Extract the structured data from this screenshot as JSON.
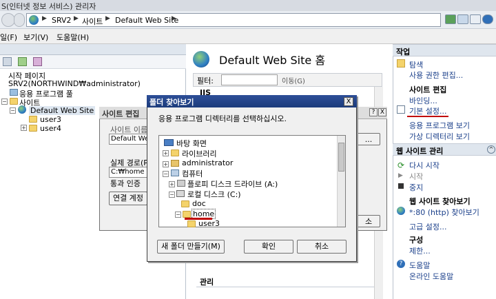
{
  "window": {
    "title": "S(인터넷 정보 서비스) 관리자"
  },
  "address": {
    "crumbs": [
      "SRV2",
      "사이트",
      "Default Web Site"
    ]
  },
  "menu": {
    "items": [
      "일(F)",
      "보기(V)",
      "도움말(H)"
    ]
  },
  "left": {
    "header": "",
    "tree": [
      {
        "label": "시작 페이지"
      },
      {
        "label": "SRV2(NORTHWIND₩administrator)"
      },
      {
        "label": "응용 프로그램 풀"
      },
      {
        "label": "사이트"
      },
      {
        "label": "Default Web Site"
      },
      {
        "label": "user3"
      },
      {
        "label": "user4"
      }
    ]
  },
  "center": {
    "title": "Default Web Site 홈",
    "filter_label": "필터:",
    "go_label": "이동(G)",
    "group_iis": "IIS",
    "group_manage": "관리"
  },
  "actions": {
    "header": "작업",
    "explore": "탐색",
    "edit_perms": "사용 권한 편집...",
    "site_edit_header": "사이트 편집",
    "bindings": "바인딩...",
    "basic_settings": "기본 설정...",
    "view_apps": "응용 프로그램 보기",
    "view_vdirs": "가상 디렉터리 보기",
    "manage_header": "웹 사이트 관리",
    "restart": "다시 시작",
    "start": "시작",
    "stop": "중지",
    "browse_header": "웹 사이트 찾아보기",
    "browse_80": "*:80 (http) 찾아보기",
    "advanced": "고급 설정...",
    "config_header": "구성",
    "limits": "제한...",
    "help": "도움말",
    "online_help": "온라인 도움말"
  },
  "edit_dialog": {
    "title": "사이트 편집",
    "site_name_label": "사이트 이름",
    "site_name_value": "Default Web",
    "physical_path_label": "실제 경로(P",
    "physical_path_value": "C:₩home",
    "passthrough_label": "통과 인증",
    "connect_as_button": "연결 계정",
    "browse_button": "...",
    "ok_fragment": "소",
    "help_button": "?",
    "close_button": "X"
  },
  "folder_dialog": {
    "title": "폴더 찾아보기",
    "instruction": "응용 프로그램 디렉터리를 선택하십시오.",
    "close": "X",
    "items": [
      {
        "label": "바탕 화면"
      },
      {
        "label": "라이브러리"
      },
      {
        "label": "administrator"
      },
      {
        "label": "컴퓨터"
      },
      {
        "label": "플로피 디스크 드라이브 (A:)"
      },
      {
        "label": "로컬 디스크 (C:)"
      },
      {
        "label": "doc"
      },
      {
        "label": "home"
      },
      {
        "label": "user3"
      }
    ],
    "new_folder_button": "새 폴더 만들기(M)",
    "ok_button": "확인",
    "cancel_button": "취소"
  }
}
